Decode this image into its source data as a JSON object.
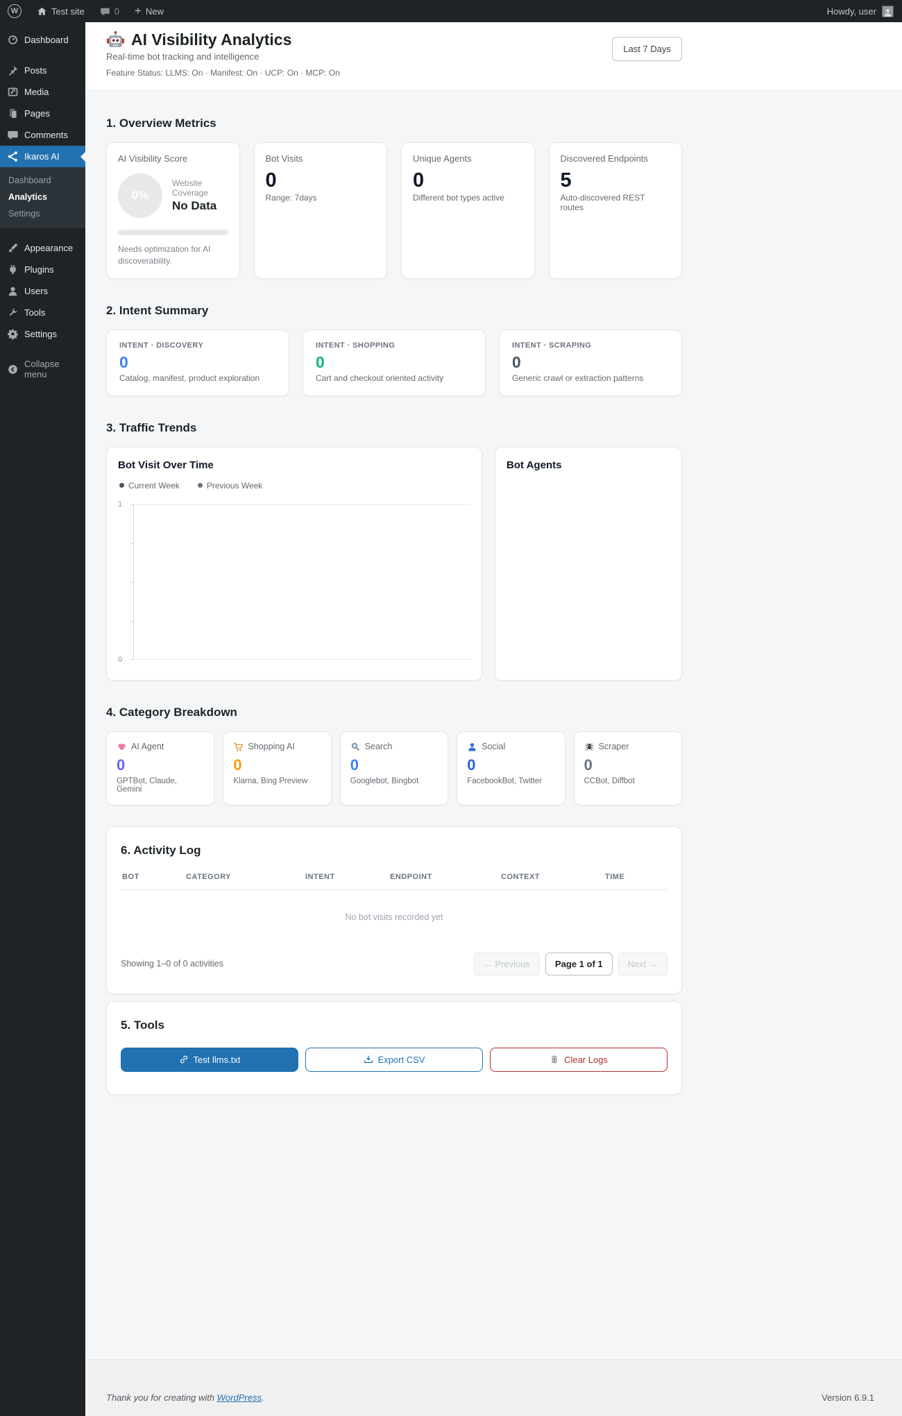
{
  "admin_bar": {
    "site_name": "Test site",
    "comment_count": "0",
    "new_label": "New",
    "howdy": "Howdy, user"
  },
  "sidebar": {
    "items": [
      {
        "label": "Dashboard",
        "icon": "dashboard-icon"
      },
      {
        "label": "Posts",
        "icon": "pin-icon"
      },
      {
        "label": "Media",
        "icon": "media-icon"
      },
      {
        "label": "Pages",
        "icon": "pages-icon"
      },
      {
        "label": "Comments",
        "icon": "comment-icon"
      },
      {
        "label": "Ikaros AI",
        "icon": "share-network-icon",
        "active": true
      },
      {
        "label": "Appearance",
        "icon": "brush-icon"
      },
      {
        "label": "Plugins",
        "icon": "plug-icon"
      },
      {
        "label": "Users",
        "icon": "user-icon"
      },
      {
        "label": "Tools",
        "icon": "wrench-icon"
      },
      {
        "label": "Settings",
        "icon": "gear-icon"
      }
    ],
    "submenu": [
      {
        "label": "Dashboard"
      },
      {
        "label": "Analytics",
        "current": true
      },
      {
        "label": "Settings"
      }
    ],
    "collapse_label": "Collapse menu"
  },
  "header": {
    "title": "AI Visibility Analytics",
    "icon": "robot-icon",
    "subtitle": "Real-time bot tracking and intelligence",
    "feature_status": "Feature Status: LLMS: On · Manifest: On · UCP: On · MCP: On",
    "range_selector": "Last 7 Days"
  },
  "overview": {
    "heading": "1. Overview Metrics",
    "score_card": {
      "label": "AI Visibility Score",
      "score": "0%",
      "coverage_label": "Website Coverage",
      "coverage_value": "No Data",
      "note": "Needs optimization for AI discoverability."
    },
    "stat_cards": [
      {
        "label": "Bot Visits",
        "value": "0",
        "sub": "Range: 7days"
      },
      {
        "label": "Unique Agents",
        "value": "0",
        "sub": "Different bot types active"
      },
      {
        "label": "Discovered Endpoints",
        "value": "5",
        "sub": "Auto-discovered REST routes"
      }
    ]
  },
  "intent": {
    "heading": "2. Intent Summary",
    "cards": [
      {
        "label": "INTENT · DISCOVERY",
        "value": "0",
        "desc": "Catalog, manifest, product exploration",
        "color": "#3b82f6"
      },
      {
        "label": "INTENT · SHOPPING",
        "value": "0",
        "desc": "Cart and checkout oriented activity",
        "color": "#10b981"
      },
      {
        "label": "INTENT · SCRAPING",
        "value": "0",
        "desc": "Generic crawl or extraction patterns",
        "color": "#4b5563"
      }
    ]
  },
  "traffic": {
    "heading": "3. Traffic Trends",
    "visits_title": "Bot Visit Over Time",
    "legend": [
      {
        "label": "Current Week",
        "color": "#4b5563"
      },
      {
        "label": "Previous Week",
        "color": "#6b7280"
      }
    ],
    "y_max": "1",
    "y_min": "0",
    "agents_title": "Bot Agents"
  },
  "category": {
    "heading": "4. Category Breakdown",
    "cards": [
      {
        "icon": "brain-icon",
        "label": "AI Agent",
        "value": "0",
        "desc": "GPTBot, Claude, Gemini",
        "color": "#6366f1"
      },
      {
        "icon": "cart-icon",
        "label": "Shopping AI",
        "value": "0",
        "desc": "Klarna, Bing Preview",
        "color": "#f59e0b"
      },
      {
        "icon": "magnifier-icon",
        "label": "Search",
        "value": "0",
        "desc": "Googlebot, Bingbot",
        "color": "#3b82f6"
      },
      {
        "icon": "bust-icon",
        "label": "Social",
        "value": "0",
        "desc": "FacebookBot, Twitter",
        "color": "#2563eb"
      },
      {
        "icon": "spider-icon",
        "label": "Scraper",
        "value": "0",
        "desc": "CCBot, Diffbot",
        "color": "#6b7280"
      }
    ]
  },
  "activity": {
    "heading": "6. Activity Log",
    "columns": [
      "BOT",
      "CATEGORY",
      "INTENT",
      "ENDPOINT",
      "CONTEXT",
      "TIME"
    ],
    "empty_message": "No bot visits recorded yet",
    "showing": "Showing 1–0 of 0 activities",
    "prev": "← Previous",
    "page": "Page 1 of 1",
    "next": "Next →"
  },
  "tools": {
    "heading": "5. Tools",
    "buttons": [
      {
        "icon": "link-icon",
        "label": "Test llms.txt",
        "style": "primary-blue"
      },
      {
        "icon": "export-icon",
        "label": "Export CSV",
        "style": "outline-blue"
      },
      {
        "icon": "trash-icon",
        "label": "Clear Logs",
        "style": "outline-red"
      }
    ]
  },
  "footer": {
    "thanks_text": "Thank you for creating with ",
    "thanks_link": "WordPress",
    "thanks_period": ".",
    "version": "Version 6.9.1"
  },
  "colors": {
    "wp_accent": "#2271b1",
    "danger": "#b32d2e",
    "admin_dark": "#1d2327",
    "content_bg": "#f5f6f7"
  },
  "chart_data": [
    {
      "type": "line",
      "title": "Bot Visit Over Time",
      "x": [],
      "series": [
        {
          "name": "Current Week",
          "values": []
        },
        {
          "name": "Previous Week",
          "values": []
        }
      ],
      "ylim": [
        0,
        1
      ],
      "yticks": [
        0,
        1
      ],
      "legend_position": "top-left",
      "grid": true
    },
    {
      "type": "bar",
      "title": "Bot Agents",
      "categories": [],
      "values": []
    }
  ]
}
